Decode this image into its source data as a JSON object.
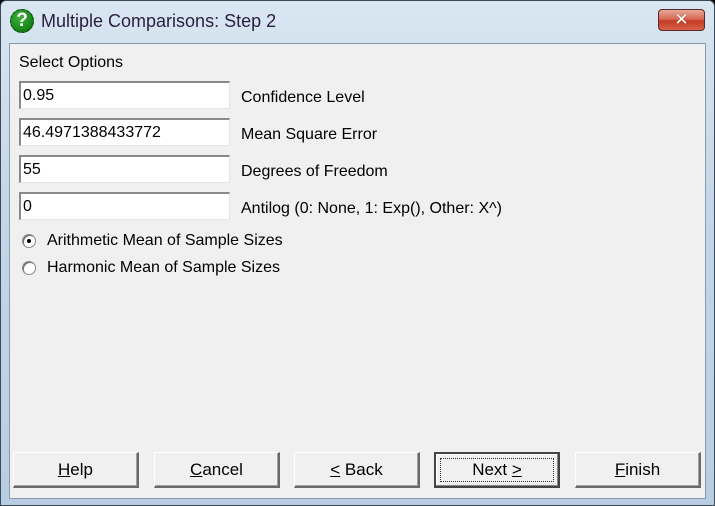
{
  "window": {
    "title": "Multiple Comparisons: Step 2",
    "icon": "help-question-icon",
    "close_glyph": "✕"
  },
  "section_label": "Select Options",
  "fields": [
    {
      "value": "0.95",
      "label": "Confidence Level"
    },
    {
      "value": "46.4971388433772",
      "label": "Mean Square Error"
    },
    {
      "value": "55",
      "label": "Degrees of Freedom"
    },
    {
      "value": "0",
      "label": "Antilog (0: None, 1: Exp(), Other: X^)"
    }
  ],
  "radios": [
    {
      "label": "Arithmetic Mean of Sample Sizes",
      "checked": true
    },
    {
      "label": "Harmonic Mean of Sample Sizes",
      "checked": false
    }
  ],
  "buttons": {
    "help": {
      "mnemonic": "H",
      "rest": "elp"
    },
    "cancel": {
      "mnemonic": "C",
      "rest": "ancel"
    },
    "back": {
      "mnemonic": "<",
      "rest": " Back"
    },
    "next": {
      "pre": "Next ",
      "mnemonic": ">"
    },
    "finish": {
      "mnemonic": "F",
      "rest": "inish"
    }
  }
}
